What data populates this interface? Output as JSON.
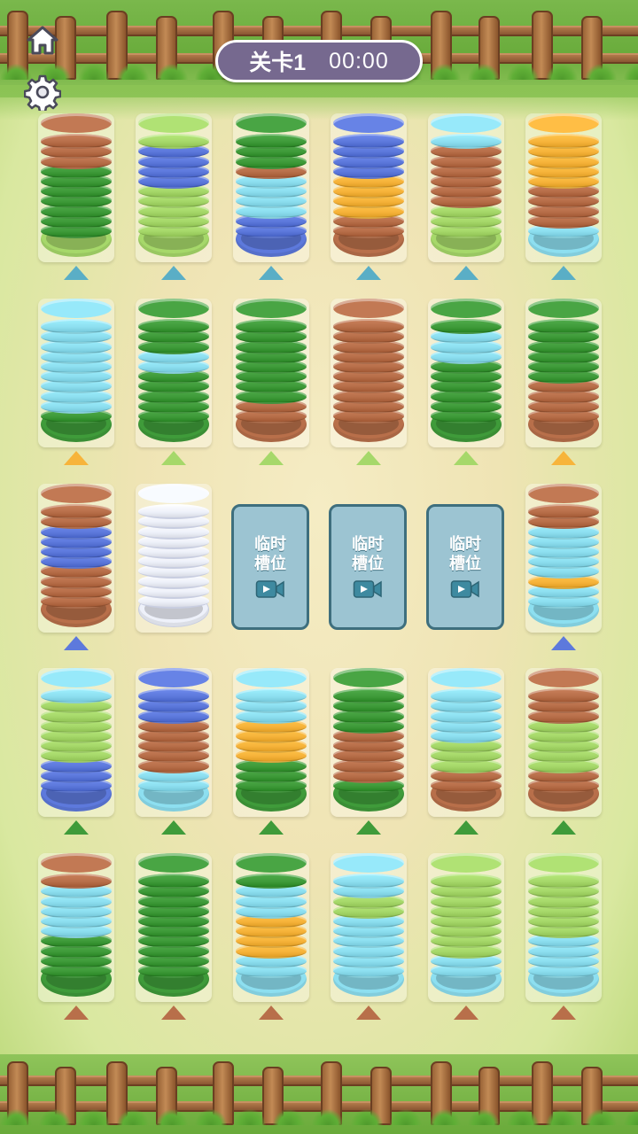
{
  "header": {
    "level_label": "关卡1",
    "timer": "00:00"
  },
  "icons": {
    "home": "home-icon",
    "settings": "gear-icon",
    "video": "video-icon"
  },
  "colors": {
    "brown": "#b86f4a",
    "dgreen": "#3f9b3a",
    "lgreen": "#a6d86a",
    "blue": "#5d79dc",
    "cyan": "#8ddff0",
    "orange": "#f7b43b",
    "white": "#eef1fa"
  },
  "temp_slot": {
    "line1": "临时",
    "line2": "槽位"
  },
  "tubes": [
    {
      "id": "r1c1",
      "arrow": "#5aaec6",
      "layers": [
        "dgreen",
        "dgreen",
        "dgreen",
        "dgreen",
        "dgreen",
        "dgreen",
        "dgreen",
        "brown",
        "brown",
        "brown"
      ],
      "top": "brown",
      "bottom": "lgreen"
    },
    {
      "id": "r1c2",
      "arrow": "#5aaec6",
      "layers": [
        "lgreen",
        "lgreen",
        "lgreen",
        "lgreen",
        "lgreen",
        "blue",
        "blue",
        "blue",
        "blue",
        "lgreen"
      ],
      "top": "lgreen",
      "bottom": "lgreen"
    },
    {
      "id": "r1c3",
      "arrow": "#5aaec6",
      "layers": [
        "blue",
        "blue",
        "cyan",
        "cyan",
        "cyan",
        "cyan",
        "brown",
        "dgreen",
        "dgreen",
        "dgreen"
      ],
      "top": "dgreen",
      "bottom": "blue"
    },
    {
      "id": "r1c4",
      "arrow": "#5aaec6",
      "layers": [
        "brown",
        "brown",
        "orange",
        "orange",
        "orange",
        "orange",
        "blue",
        "blue",
        "blue",
        "blue"
      ],
      "top": "blue",
      "bottom": "brown"
    },
    {
      "id": "r1c5",
      "arrow": "#5aaec6",
      "layers": [
        "lgreen",
        "lgreen",
        "lgreen",
        "brown",
        "brown",
        "brown",
        "brown",
        "brown",
        "brown",
        "cyan"
      ],
      "top": "cyan",
      "bottom": "lgreen"
    },
    {
      "id": "r1c6",
      "arrow": "#5aaec6",
      "layers": [
        "cyan",
        "brown",
        "brown",
        "brown",
        "brown",
        "orange",
        "orange",
        "orange",
        "orange",
        "orange"
      ],
      "top": "orange",
      "bottom": "cyan"
    },
    {
      "id": "r2c1",
      "arrow": "#f7b43b",
      "layers": [
        "dgreen",
        "cyan",
        "cyan",
        "cyan",
        "cyan",
        "cyan",
        "cyan",
        "cyan",
        "cyan",
        "cyan"
      ],
      "top": "cyan",
      "bottom": "dgreen"
    },
    {
      "id": "r2c2",
      "arrow": "#a6d86a",
      "layers": [
        "dgreen",
        "dgreen",
        "dgreen",
        "dgreen",
        "dgreen",
        "cyan",
        "cyan",
        "dgreen",
        "dgreen",
        "dgreen"
      ],
      "top": "dgreen",
      "bottom": "dgreen"
    },
    {
      "id": "r2c3",
      "arrow": "#a6d86a",
      "layers": [
        "brown",
        "brown",
        "dgreen",
        "dgreen",
        "dgreen",
        "dgreen",
        "dgreen",
        "dgreen",
        "dgreen",
        "dgreen"
      ],
      "top": "dgreen",
      "bottom": "brown"
    },
    {
      "id": "r2c4",
      "arrow": "#a6d86a",
      "layers": [
        "brown",
        "brown",
        "brown",
        "brown",
        "brown",
        "brown",
        "brown",
        "brown",
        "brown",
        "brown"
      ],
      "top": "brown",
      "bottom": "brown"
    },
    {
      "id": "r2c5",
      "arrow": "#a6d86a",
      "layers": [
        "dgreen",
        "dgreen",
        "dgreen",
        "dgreen",
        "dgreen",
        "dgreen",
        "cyan",
        "cyan",
        "cyan",
        "dgreen"
      ],
      "top": "dgreen",
      "bottom": "dgreen"
    },
    {
      "id": "r2c6",
      "arrow": "#f7b43b",
      "layers": [
        "brown",
        "brown",
        "brown",
        "brown",
        "dgreen",
        "dgreen",
        "dgreen",
        "dgreen",
        "dgreen",
        "dgreen"
      ],
      "top": "dgreen",
      "bottom": "brown"
    },
    {
      "id": "r3c1",
      "arrow": "#5d79dc",
      "layers": [
        "brown",
        "brown",
        "brown",
        "brown",
        "blue",
        "blue",
        "blue",
        "blue",
        "brown",
        "brown"
      ],
      "top": "brown",
      "bottom": "brown"
    },
    {
      "id": "r3c2",
      "arrow": "",
      "layers": [
        "white",
        "white",
        "white",
        "white",
        "white",
        "white",
        "white",
        "white",
        "white",
        "white"
      ],
      "top": "white",
      "bottom": "white",
      "empty": true
    },
    {
      "id": "r3c6",
      "arrow": "#5d79dc",
      "layers": [
        "cyan",
        "cyan",
        "orange",
        "cyan",
        "cyan",
        "cyan",
        "cyan",
        "cyan",
        "brown",
        "brown"
      ],
      "top": "brown",
      "bottom": "cyan"
    },
    {
      "id": "r4c1",
      "arrow": "#3f9b3a",
      "layers": [
        "blue",
        "blue",
        "blue",
        "lgreen",
        "lgreen",
        "lgreen",
        "lgreen",
        "lgreen",
        "lgreen",
        "cyan"
      ],
      "top": "cyan",
      "bottom": "blue"
    },
    {
      "id": "r4c2",
      "arrow": "#3f9b3a",
      "layers": [
        "cyan",
        "cyan",
        "brown",
        "brown",
        "brown",
        "brown",
        "brown",
        "blue",
        "blue",
        "blue"
      ],
      "top": "blue",
      "bottom": "cyan"
    },
    {
      "id": "r4c3",
      "arrow": "#3f9b3a",
      "layers": [
        "dgreen",
        "dgreen",
        "dgreen",
        "orange",
        "orange",
        "orange",
        "orange",
        "cyan",
        "cyan",
        "cyan"
      ],
      "top": "cyan",
      "bottom": "dgreen"
    },
    {
      "id": "r4c4",
      "arrow": "#3f9b3a",
      "layers": [
        "dgreen",
        "brown",
        "brown",
        "brown",
        "brown",
        "brown",
        "dgreen",
        "dgreen",
        "dgreen",
        "dgreen"
      ],
      "top": "dgreen",
      "bottom": "dgreen"
    },
    {
      "id": "r4c5",
      "arrow": "#3f9b3a",
      "layers": [
        "brown",
        "brown",
        "lgreen",
        "lgreen",
        "lgreen",
        "cyan",
        "cyan",
        "cyan",
        "cyan",
        "cyan"
      ],
      "top": "cyan",
      "bottom": "brown"
    },
    {
      "id": "r4c6",
      "arrow": "#3f9b3a",
      "layers": [
        "brown",
        "brown",
        "lgreen",
        "lgreen",
        "lgreen",
        "lgreen",
        "lgreen",
        "brown",
        "brown",
        "brown"
      ],
      "top": "brown",
      "bottom": "brown"
    },
    {
      "id": "r5c1",
      "arrow": "#b86f4a",
      "layers": [
        "dgreen",
        "dgreen",
        "dgreen",
        "dgreen",
        "cyan",
        "cyan",
        "cyan",
        "cyan",
        "cyan",
        "brown"
      ],
      "top": "brown",
      "bottom": "dgreen"
    },
    {
      "id": "r5c2",
      "arrow": "#b86f4a",
      "layers": [
        "dgreen",
        "dgreen",
        "dgreen",
        "dgreen",
        "dgreen",
        "dgreen",
        "dgreen",
        "dgreen",
        "dgreen",
        "dgreen"
      ],
      "top": "dgreen",
      "bottom": "dgreen"
    },
    {
      "id": "r5c3",
      "arrow": "#b86f4a",
      "layers": [
        "cyan",
        "cyan",
        "orange",
        "orange",
        "orange",
        "orange",
        "cyan",
        "cyan",
        "cyan",
        "dgreen"
      ],
      "top": "dgreen",
      "bottom": "cyan"
    },
    {
      "id": "r5c4",
      "arrow": "#b86f4a",
      "layers": [
        "cyan",
        "cyan",
        "cyan",
        "cyan",
        "cyan",
        "cyan",
        "lgreen",
        "lgreen",
        "cyan",
        "cyan"
      ],
      "top": "cyan",
      "bottom": "cyan"
    },
    {
      "id": "r5c5",
      "arrow": "#b86f4a",
      "layers": [
        "cyan",
        "cyan",
        "lgreen",
        "lgreen",
        "lgreen",
        "lgreen",
        "lgreen",
        "lgreen",
        "lgreen",
        "lgreen"
      ],
      "top": "lgreen",
      "bottom": "cyan"
    },
    {
      "id": "r5c6",
      "arrow": "#b86f4a",
      "layers": [
        "cyan",
        "cyan",
        "cyan",
        "cyan",
        "lgreen",
        "lgreen",
        "lgreen",
        "lgreen",
        "lgreen",
        "lgreen"
      ],
      "top": "lgreen",
      "bottom": "cyan"
    }
  ]
}
